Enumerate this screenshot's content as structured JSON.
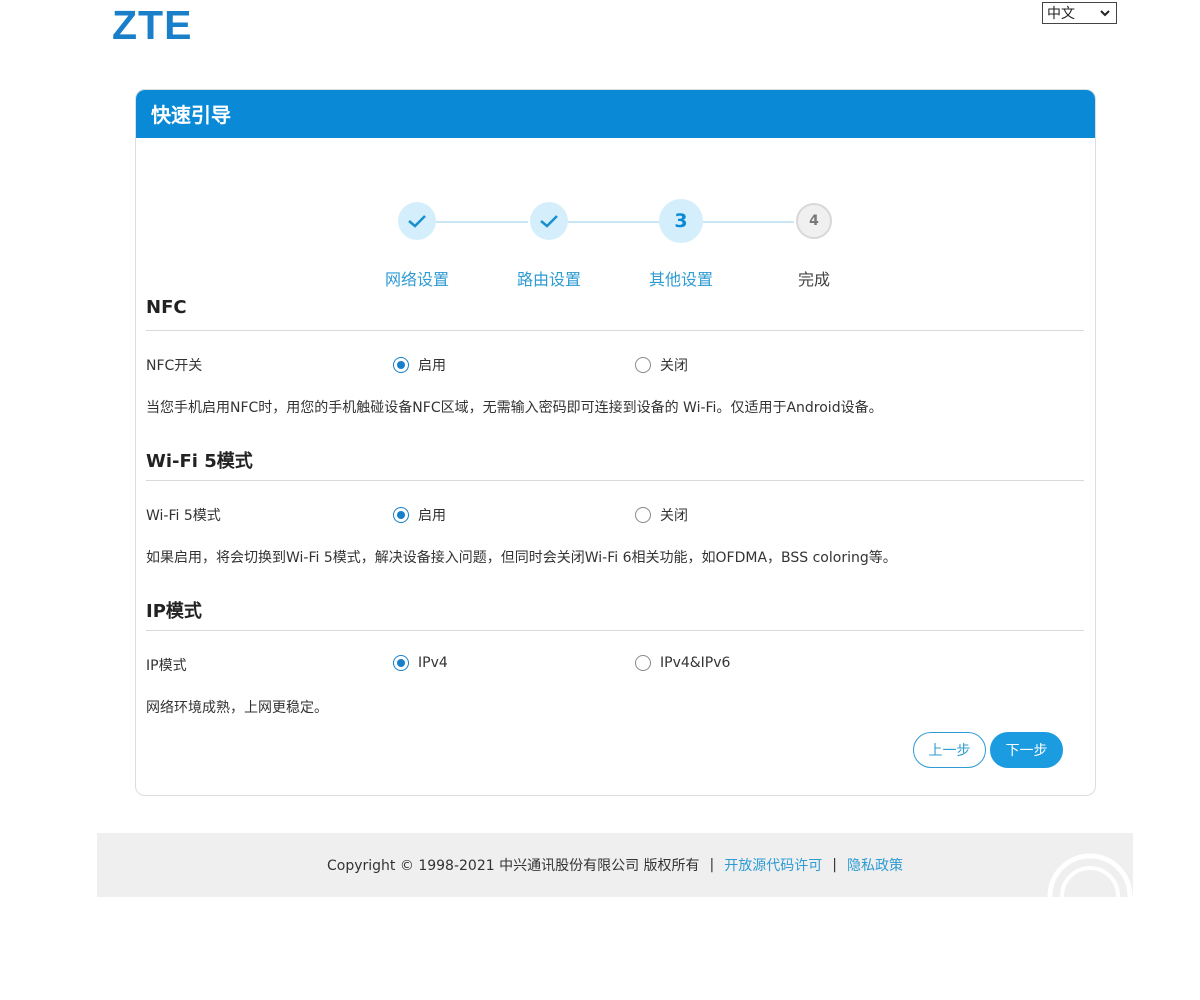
{
  "header": {
    "logo_text": "ZTE",
    "language_selected": "中文"
  },
  "card": {
    "title": "快速引导"
  },
  "stepper": {
    "steps": [
      {
        "label": "网络设置",
        "state": "done"
      },
      {
        "label": "路由设置",
        "state": "done"
      },
      {
        "label": "其他设置",
        "state": "current",
        "number": "3"
      },
      {
        "label": "完成",
        "state": "todo",
        "number": "4"
      }
    ]
  },
  "sections": {
    "nfc": {
      "title": "NFC",
      "row_label": "NFC开关",
      "option_on": "启用",
      "option_off": "关闭",
      "selected": "启用",
      "description": "当您手机启用NFC时，用您的手机触碰设备NFC区域，无需输入密码即可连接到设备的 Wi-Fi。仅适用于Android设备。"
    },
    "wifi5": {
      "title": "Wi-Fi 5模式",
      "row_label": "Wi-Fi 5模式",
      "option_on": "启用",
      "option_off": "关闭",
      "selected": "启用",
      "description": "如果启用，将会切换到Wi-Fi 5模式，解决设备接入问题，但同时会关闭Wi-Fi 6相关功能，如OFDMA，BSS coloring等。"
    },
    "ip": {
      "title": "IP模式",
      "row_label": "IP模式",
      "option_a": "IPv4",
      "option_b": "IPv4&IPv6",
      "selected": "IPv4",
      "description": "网络环境成熟，上网更稳定。"
    }
  },
  "buttons": {
    "prev_label": "上一步",
    "next_label": "下一步"
  },
  "footer": {
    "copyright": "Copyright © 1998-2021 中兴通讯股份有限公司 版权所有",
    "separator": "|",
    "open_source_link": "开放源代码许可",
    "privacy_link": "隐私政策"
  },
  "colors": {
    "brand_blue": "#0a8ad6",
    "link_blue": "#2e9bd3"
  }
}
